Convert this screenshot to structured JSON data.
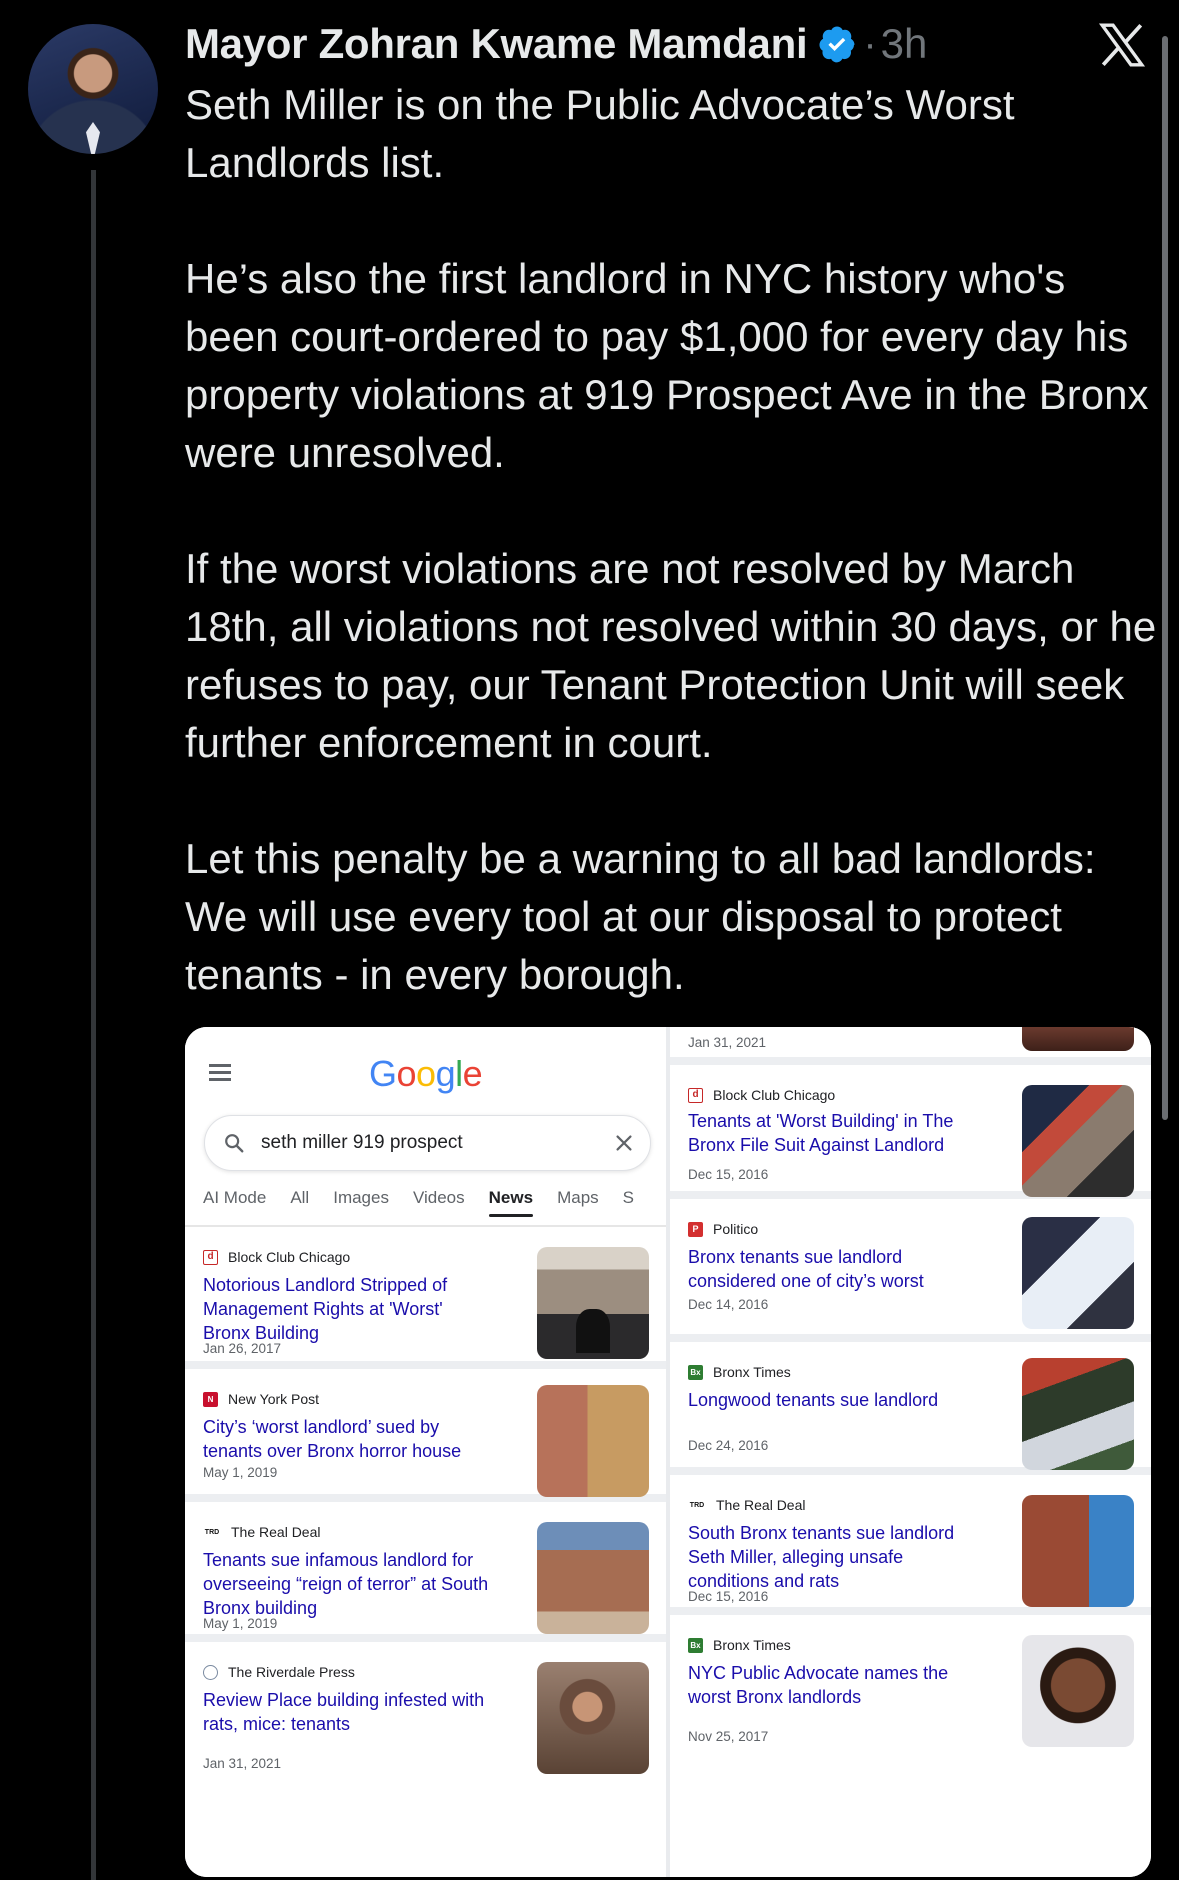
{
  "tweet": {
    "author": "Mayor Zohran Kwame Mamdani",
    "separator": "·",
    "time": "3h",
    "paragraphs": [
      "Seth Miller is on the Public Advocate’s Worst Landlords list.",
      "He’s also the first landlord in NYC history who's been court-ordered to pay $1,000 for every day his property violations at 919 Prospect Ave in the Bronx were unresolved.",
      "If the worst violations are not resolved by March 18th, all violations not resolved within 30 days, or he refuses to pay, our Tenant Protection Unit will seek further enforcement in court.",
      "Let this penalty be a warning to all bad landlords: We will use every tool at our disposal to protect tenants - in every borough."
    ]
  },
  "colors": {
    "background": "#000000",
    "text": "#e7e9ea",
    "muted": "#71767b",
    "verified": "#1d9bf0",
    "link": "#1a0dab"
  },
  "google": {
    "logo": [
      "G",
      "o",
      "o",
      "g",
      "l",
      "e"
    ],
    "search_value": "seth miller 919 prospect",
    "tabs": [
      "AI Mode",
      "All",
      "Images",
      "Videos",
      "News",
      "Maps",
      "S"
    ],
    "active_tab": "News",
    "left_results": [
      {
        "source": "Block Club Chicago",
        "title": "Notorious Landlord Stripped of Management Rights at 'Worst' Bronx Building",
        "date": "Jan 26, 2017"
      },
      {
        "source": "New York Post",
        "title": "City’s ‘worst landlord’ sued by tenants over Bronx horror house",
        "date": "May 1, 2019"
      },
      {
        "source": "The Real Deal",
        "title": "Tenants sue infamous landlord for overseeing “reign of terror” at South Bronx building",
        "date": "May 1, 2019"
      },
      {
        "source": "The Riverdale Press",
        "title": "Review Place building infested with rats, mice: tenants",
        "date": "Jan 31, 2021"
      }
    ],
    "right_top_date": "Jan 31, 2021",
    "right_results": [
      {
        "source": "Block Club Chicago",
        "title": "Tenants at 'Worst Building' in The Bronx File Suit Against Landlord",
        "date": "Dec 15, 2016"
      },
      {
        "source": "Politico",
        "title": "Bronx tenants sue landlord considered one of city’s worst",
        "date": "Dec 14, 2016"
      },
      {
        "source": "Bronx Times",
        "title": "Longwood tenants sue landlord",
        "date": "Dec 24, 2016"
      },
      {
        "source": "The Real Deal",
        "title": "South Bronx tenants sue landlord Seth Miller, alleging unsafe conditions and rats",
        "date": "Dec 15, 2016"
      },
      {
        "source": "Bronx Times",
        "title": "NYC Public Advocate names the worst Bronx landlords",
        "date": "Nov 25, 2017"
      }
    ],
    "favicons": {
      "block_club": "d",
      "nypost": "N",
      "real_deal": "TRD",
      "politico": "P",
      "bronx_times": "Bx"
    }
  }
}
